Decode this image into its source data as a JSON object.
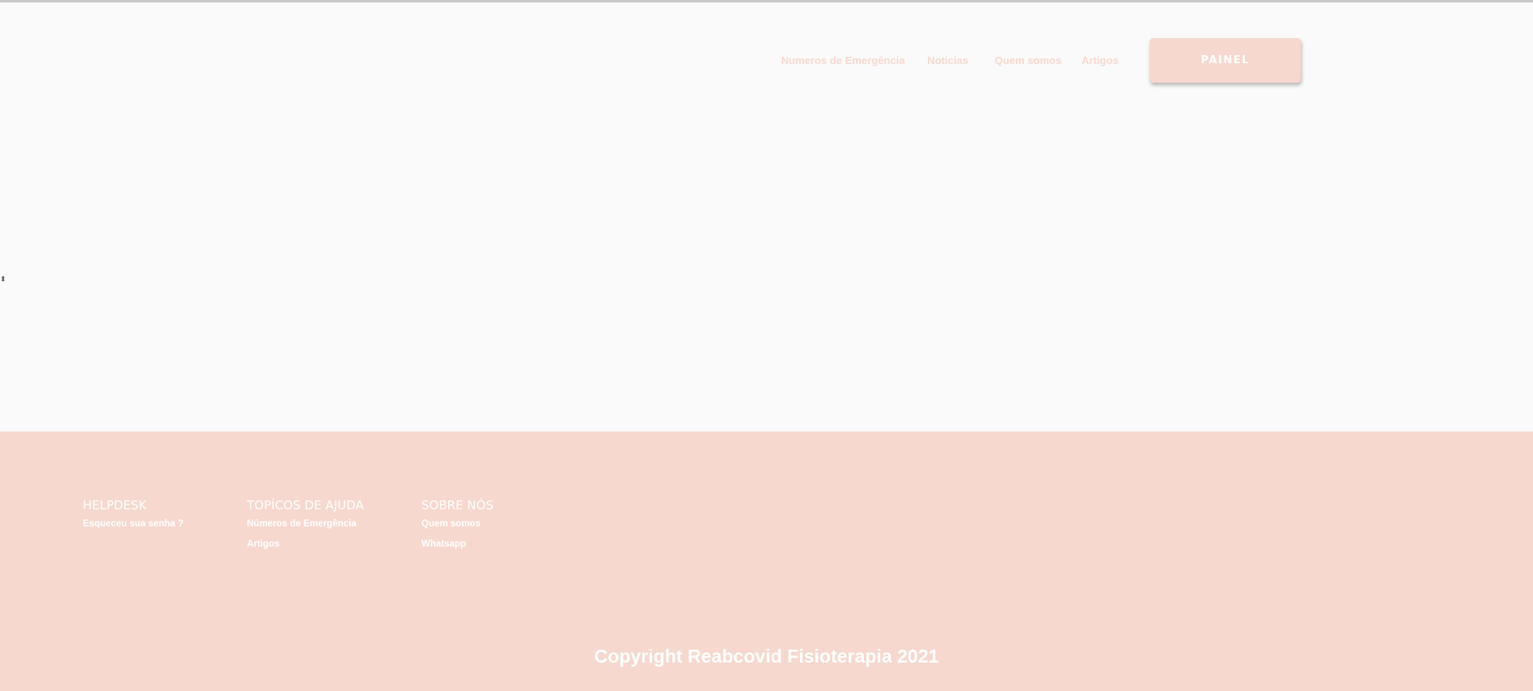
{
  "header": {
    "nav": {
      "emergencia": "Numeros de Emergência",
      "noticias": "Noticias",
      "quem_somos": "Quem somos",
      "artigos": "Artigos"
    },
    "painel_label": "PAINEL"
  },
  "caret_glyph": "⬍",
  "footer": {
    "helpdesk": {
      "title": "HELPDESK",
      "links": [
        "Esqueceu sua senha ?"
      ]
    },
    "topicos": {
      "title": "TOPÍCOS DE AJUDA",
      "links": [
        "Números de Emergência",
        "Artigos"
      ]
    },
    "sobre": {
      "title": "SOBRE NÓS",
      "links": [
        "Quem somos",
        "Whatsapp"
      ]
    },
    "copyright": "Copyright Reabcovid Fisioterapia 2021"
  },
  "colors": {
    "accent": "#f6d8cf",
    "page_background": "#fafafa",
    "footer_text": "#ffffff"
  }
}
